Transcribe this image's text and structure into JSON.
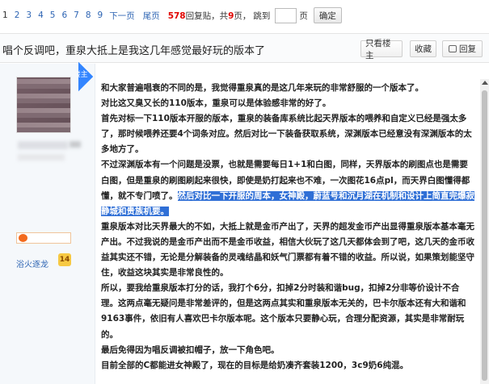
{
  "pager": {
    "pages": [
      "1",
      "2",
      "3",
      "4",
      "5",
      "6",
      "7",
      "8",
      "9"
    ],
    "current": "1",
    "next": "下一页",
    "last": "尾页",
    "reply_count": "578",
    "reply_label": "回复贴，共",
    "page_total": "9",
    "page_unit": "页，",
    "jump_label": "跳到",
    "jump_unit": "页",
    "confirm": "确定"
  },
  "thread": {
    "title": "唱个反调吧，重泉大抵上是我这几年感觉最好玩的版本了",
    "btn_host_only": "只看楼主",
    "btn_favorite": "收藏",
    "btn_reply": "回复"
  },
  "author": {
    "host_tag": "楼主",
    "forum_name": "浴火逐龙",
    "level": "14"
  },
  "post": {
    "p1": "和大家普遍唱衰的不同的是，我觉得重泉真的是这几年来玩的非常舒服的一个版本了。",
    "p2": "对比这又臭又长的110版本，重泉可以是体验感非常的好了。",
    "p3": "首先对标一下110版本开服的版本，重泉的装备库系统比起天界版本的喂养和自定义已经是强太多了，那时候喂养还要4个词条对应。然后对比一下装备获取系统，深渊版本已经意没有深渊版本的太多地方了。",
    "p4_a": "不过深渊版本有一个问题是没票，也就是需要每日1+1和白图，同样，天界版本的刷图点也是需要白图，但是重泉的刷图刷起来很快，即使是奶打起来也不难，一次图花16点pl，而天界白图懂得都懂，就不专门喷了。",
    "p4_sel": "然后对比一下开服的周本，女神殿，蔚蓝号和沉月湖在机制和设计上简直完爆寂静城和贵族机要。",
    "p5": "重泉版本对比天界最大的不如，大抵上就是金币产出了，天界的超发金币产出显得重泉版本基本毫无产出。不过我说的是金币产出而不是金币收益，相信大伙玩了这几天都体会到了吧，这几天的金币收益其实还不错，无论是分解装备的灵魂结晶和妖气门票都有着不错的收益。所以说，如果策划能坚守住，收益这块其实是非常良性的。",
    "p6": "所以，要我给重泉版本打分的话，我打个6分，扣掉2分时装和谐bug，扣掉2分非等价设计不合理。这两点毫无疑问是非常差评的，但是这两点其实和重泉版本无关的，巴卡尔版本还有大和谐和9163事件，依旧有人喜欢巴卡尔版本呢。这个版本只要静心玩，合理分配资源，其实是非常耐玩的。",
    "p7": "最后免得因为唱反调被扣帽子，放一下角色吧。",
    "p8": "目前全部的C都能进女神殿了，现在的目标是给奶凑齐套装1200，3c9奶6纯混。"
  }
}
